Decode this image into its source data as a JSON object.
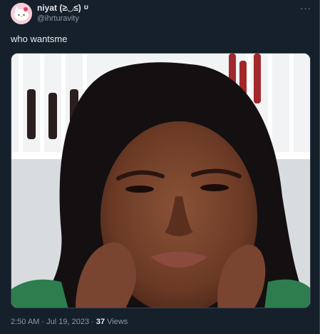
{
  "user": {
    "display_name": "niyat (≥◡≤)",
    "handle": "@ihrturavity",
    "badge_glyph": "ʊ"
  },
  "tweet": {
    "text": "who wantsme",
    "more_glyph": "···"
  },
  "meta": {
    "time": "2:50 AM",
    "separator1": " · ",
    "date": "Jul 19, 2023",
    "separator2": " · ",
    "views_count": "37",
    "views_label": " Views"
  },
  "media": {
    "subject": "selfie-photo"
  }
}
